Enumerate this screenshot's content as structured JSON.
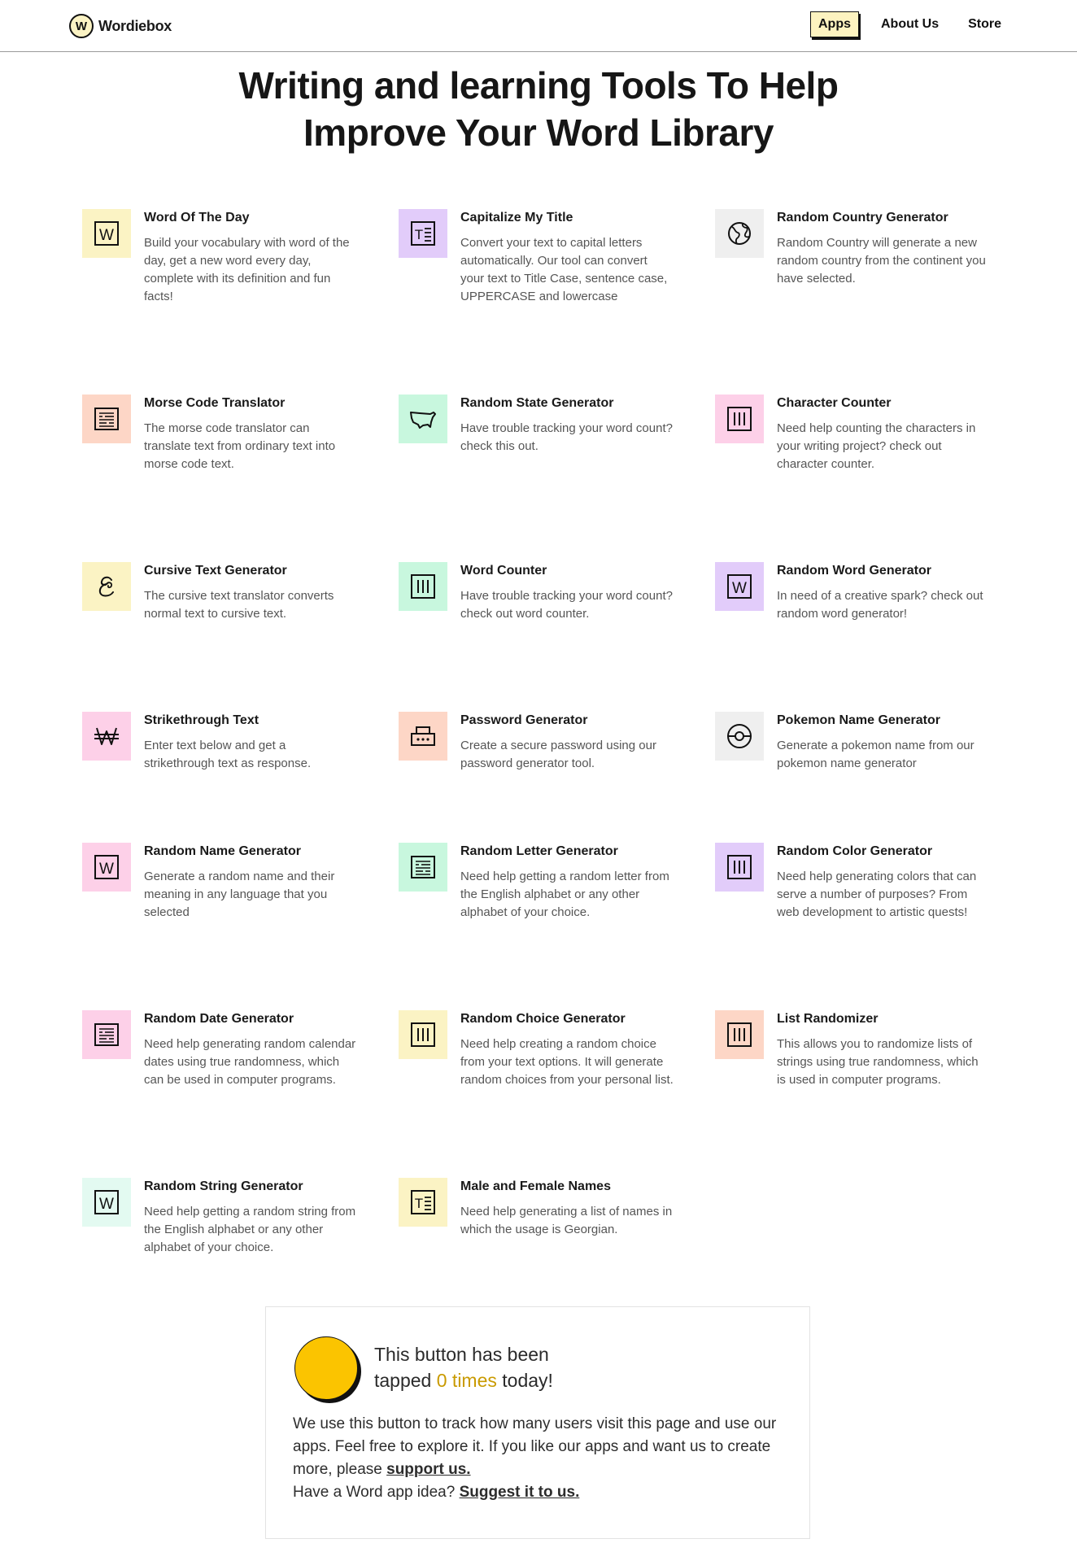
{
  "header": {
    "logo_letter": "W",
    "logo_text": "Wordiebox",
    "nav": [
      {
        "label": "Apps",
        "active": true
      },
      {
        "label": "About Us"
      },
      {
        "label": "Store"
      }
    ]
  },
  "hero": {
    "title_line1": "Writing and learning Tools To Help",
    "title_line2": "Improve Your Word Library"
  },
  "colors": {
    "yellow": "#fbf3c4",
    "purple": "#e2ccfa",
    "gray": "#efefef",
    "peach": "#fdd6c6",
    "green": "#c8f7de",
    "pink": "#fdd0e8",
    "mint": "#e3faf1",
    "accent": "#fbc400",
    "highlight_text": "#c99a00"
  },
  "tools": [
    {
      "title": "Word Of The Day",
      "desc": "Build your vocabulary with word of the day, get a new word every day, complete with its definition and fun facts!",
      "icon": "w-icon",
      "color": "yellow"
    },
    {
      "title": "Capitalize My Title",
      "desc": "Convert your text to capital letters automatically. Our tool can convert your text to Title Case, sentence case, UPPERCASE and lowercase",
      "icon": "text-format-icon",
      "color": "purple"
    },
    {
      "title": "Random Country Generator",
      "desc": "Random Country will generate a new random country from the continent you have selected.",
      "icon": "globe-icon",
      "color": "gray"
    },
    {
      "title": "Morse Code Translator",
      "desc": "The morse code translator can translate text from ordinary text into morse code text.",
      "icon": "document-lines-icon",
      "color": "peach"
    },
    {
      "title": "Random State Generator",
      "desc": "Have trouble tracking your word count? check this out.",
      "icon": "us-map-icon",
      "color": "green"
    },
    {
      "title": "Character Counter",
      "desc": "Need help counting the characters in your writing project? check out character counter.",
      "icon": "bars-icon",
      "color": "pink"
    },
    {
      "title": "Cursive Text Generator",
      "desc": "The cursive text translator converts normal text to cursive text.",
      "icon": "cursive-icon",
      "color": "yellow"
    },
    {
      "title": "Word Counter",
      "desc": "Have trouble tracking your word count? check out word counter.",
      "icon": "bars-icon",
      "color": "green"
    },
    {
      "title": "Random Word Generator",
      "desc": "In need of a creative spark? check out random word generator!",
      "icon": "w-icon",
      "color": "purple"
    },
    {
      "title": "Strikethrough Text",
      "desc": "Enter text below and get a strikethrough text as response.",
      "icon": "strikethrough-icon",
      "color": "pink"
    },
    {
      "title": "Password Generator",
      "desc": "Create a secure password using our password generator tool.",
      "icon": "password-icon",
      "color": "peach"
    },
    {
      "title": "Pokemon Name Generator",
      "desc": "Generate a pokemon name from our pokemon name generator",
      "icon": "pokeball-icon",
      "color": "gray"
    },
    {
      "title": "Random Name Generator",
      "desc": "Generate a random name and their meaning in any language that you selected",
      "icon": "w-icon",
      "color": "pink"
    },
    {
      "title": "Random Letter Generator",
      "desc": "Need help getting a random letter from the English alphabet or any other alphabet of your choice.",
      "icon": "document-lines-icon",
      "color": "green"
    },
    {
      "title": "Random Color Generator",
      "desc": "Need help generating colors that can serve a number of purposes? From web development to artistic quests!",
      "icon": "bars-icon",
      "color": "purple"
    },
    {
      "title": "Random Date Generator",
      "desc": "Need help generating random calendar dates using true randomness, which can be used in computer programs.",
      "icon": "document-lines-icon",
      "color": "pink"
    },
    {
      "title": "Random Choice Generator",
      "desc": "Need help creating a random choice from your text options. It will generate random choices from your personal list.",
      "icon": "bars-icon",
      "color": "yellow"
    },
    {
      "title": "List Randomizer",
      "desc": "This allows you to randomize lists of strings using true randomness, which is used in computer programs.",
      "icon": "bars-icon",
      "color": "peach"
    },
    {
      "title": "Random String Generator",
      "desc": "Need help getting a random string from the English alphabet or any other alphabet of your choice.",
      "icon": "w-icon",
      "color": "mint"
    },
    {
      "title": "Male and Female Names",
      "desc": "Need help generating a list of names in which the usage is Georgian.",
      "icon": "text-format-icon",
      "color": "yellow"
    }
  ],
  "counter": {
    "line1": "This button has been",
    "line2_prefix": "tapped ",
    "count_text": "0 times",
    "line2_suffix": " today!",
    "desc_part1": "We use this button to track how many users visit this page and use our apps. Feel free to explore it. If you like our apps and want us to create more, please ",
    "support_link": "support us.",
    "desc_part2": "Have a Word app idea? ",
    "suggest_link": "Suggest it to us."
  }
}
